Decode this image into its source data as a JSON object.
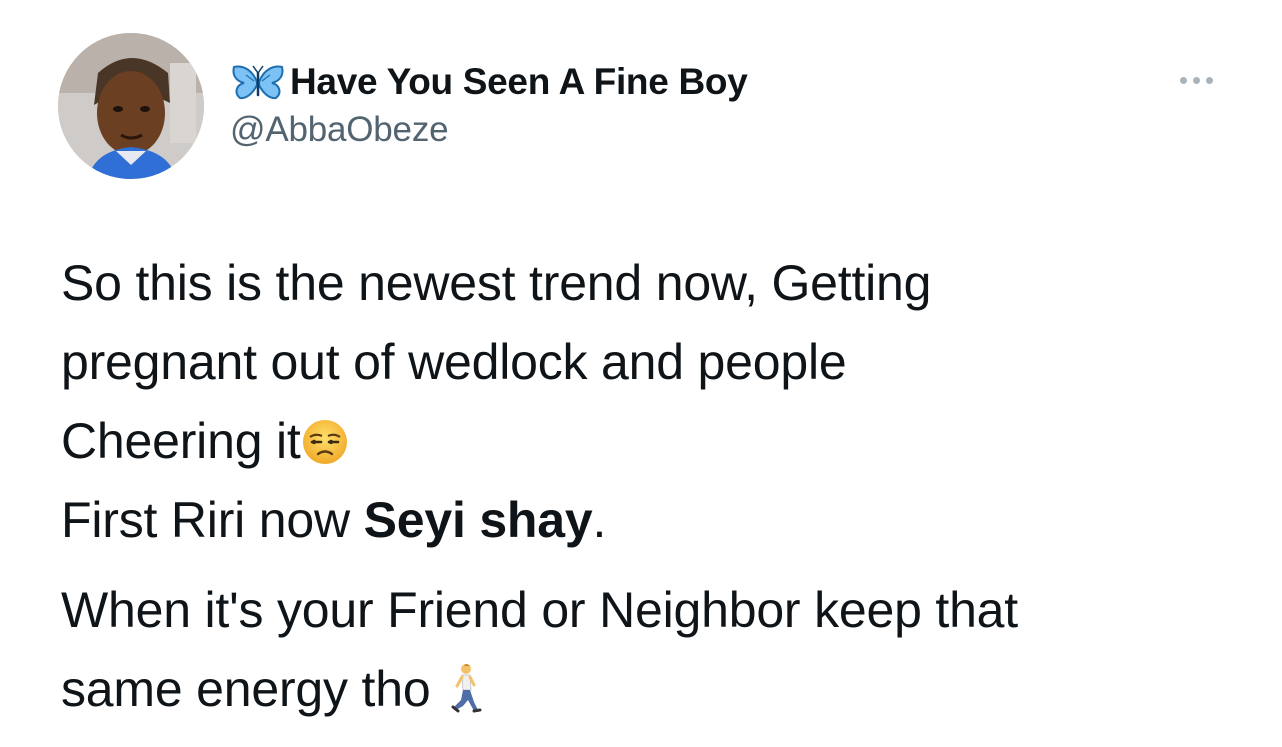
{
  "author": {
    "display_name": "Have You Seen A Fine Boy",
    "handle": "@AbbaObeze",
    "name_prefix_icon": "butterfly-icon"
  },
  "menu": {
    "icon": "more-options-icon"
  },
  "tweet": {
    "line1": "So this is the newest trend now, Getting",
    "line2": "pregnant out of wedlock and people",
    "line3": "Cheering it",
    "line3_emoji": "unamused-face-emoji",
    "line4_prefix": "First Riri now ",
    "line4_bold": "Seyi shay",
    "line4_suffix": ".",
    "line5": "When it's your Friend or Neighbor keep that",
    "line6": "same energy tho",
    "line6_emoji": "person-walking-emoji"
  },
  "colors": {
    "text": "#0f1419",
    "secondary": "#536471",
    "butterfly_blue": "#1d9bf0",
    "emoji_yellow": "#f7c430"
  }
}
